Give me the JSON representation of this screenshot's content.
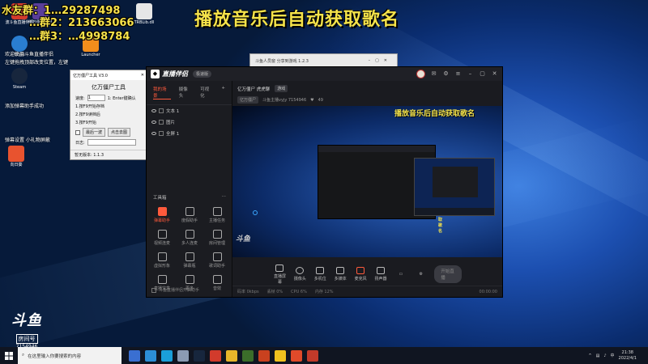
{
  "overlay": {
    "line1": "水友群：1…29287498",
    "line2": "…群2：213663066",
    "line3": "…群3：…4998784",
    "headline": "播放音乐后自动获取歌名"
  },
  "desktop_icons": [
    {
      "label": "波斗鱼直播伴侣",
      "color": "#d23b2c"
    },
    {
      "label": "亿万僵尸工具",
      "color": "#5a3e9a"
    },
    {
      "label": "Edge",
      "color": "#2a7ed1"
    },
    {
      "label": "TRBLib.dll",
      "color": "#e6e6e6"
    },
    {
      "label": "Launcher",
      "color": "#f28d1c"
    },
    {
      "label": "Steam",
      "color": "#17263d"
    },
    {
      "label": "向日葵",
      "color": "#e8532f"
    }
  ],
  "desktop_notes": {
    "n1": "欢迎使用斗鱼直播伴侣",
    "n2": "左键拖拽顶部改变位置，左键",
    "n3": "添加弹幕助手成功",
    "n4": "弹幕设置 小礼物屏蔽"
  },
  "tool_window": {
    "title": "亿万僵尸工具 V3.0",
    "heading": "亿万僵尸工具",
    "speed_label": "速度:",
    "speed_value": "1",
    "hint": "1: Enter键确认",
    "step1": "1.按F9开始存档",
    "step2": "2.按F9读档后",
    "step3": "3.按F9开始",
    "btn_prev": "最后一波",
    "btn_export": "点击去图",
    "log_label": "日志:",
    "status": "暂无版本: 1.1.3"
  },
  "background_window": {
    "title": "斗鱼人员窗 分享到游戏 1.2.3"
  },
  "app": {
    "logo": "直播伴侣",
    "version": "极速版",
    "tabs": [
      "我的场景",
      "摄像头",
      "可视化"
    ],
    "scenes": [
      "文本 1",
      "图片",
      "全屏 1"
    ],
    "room_name": "亿万僵尸 虎虎聊",
    "room_tag": "游戏",
    "category": "亿万僵尸",
    "host": "斗鱼主播vyjy 7154946",
    "fans": "49",
    "tools_title": "工具箱",
    "tools": [
      {
        "label": "弹幕助手",
        "hot": true
      },
      {
        "label": "度假助手",
        "hot": false
      },
      {
        "label": "主播任务",
        "hot": false
      },
      {
        "label": "视频连麦",
        "hot": false
      },
      {
        "label": "多人连麦",
        "hot": false
      },
      {
        "label": "房间管理",
        "hot": false
      },
      {
        "label": "虚拟形象",
        "hot": false
      },
      {
        "label": "弹幕瓶",
        "hot": false
      },
      {
        "label": "歌词助手",
        "hot": false
      },
      {
        "label": "直播宝盒",
        "hot": false
      },
      {
        "label": "更多",
        "hot": false
      },
      {
        "label": "音效",
        "hot": false
      }
    ],
    "live_check": "斗鱼直播伴侣开启助手",
    "preview_title": "播放音乐后自动获取歌名",
    "preview_nested_title": "播放音乐后自动获取歌名",
    "preview_logo": "斗鱼",
    "controls": [
      "直播屏幕",
      "摄像头",
      "多机位",
      "多媒体",
      "麦克风",
      "扬声器"
    ],
    "start_button": "开始直播",
    "stats": [
      "码率 0kbps",
      "丢帧 0%",
      "CPU 6%",
      "内存 12%"
    ],
    "stats_right": "00:00:00"
  },
  "douyu_badge": {
    "brand": "斗鱼",
    "room": "房间号",
    "room_id": "7154946"
  },
  "taskbar": {
    "search_placeholder": "在这里输入你要搜索的内容",
    "apps": [
      "#3a6fd1",
      "#2c8ed6",
      "#1a9fd9",
      "#8b9bb3",
      "#17263d",
      "#d23b2c",
      "#e7b52a",
      "#3b6d2a",
      "#c9411f",
      "#f0c21e",
      "#e04a2a",
      "#c23a2a"
    ],
    "time": "21:38",
    "date": "2022/4/1"
  }
}
